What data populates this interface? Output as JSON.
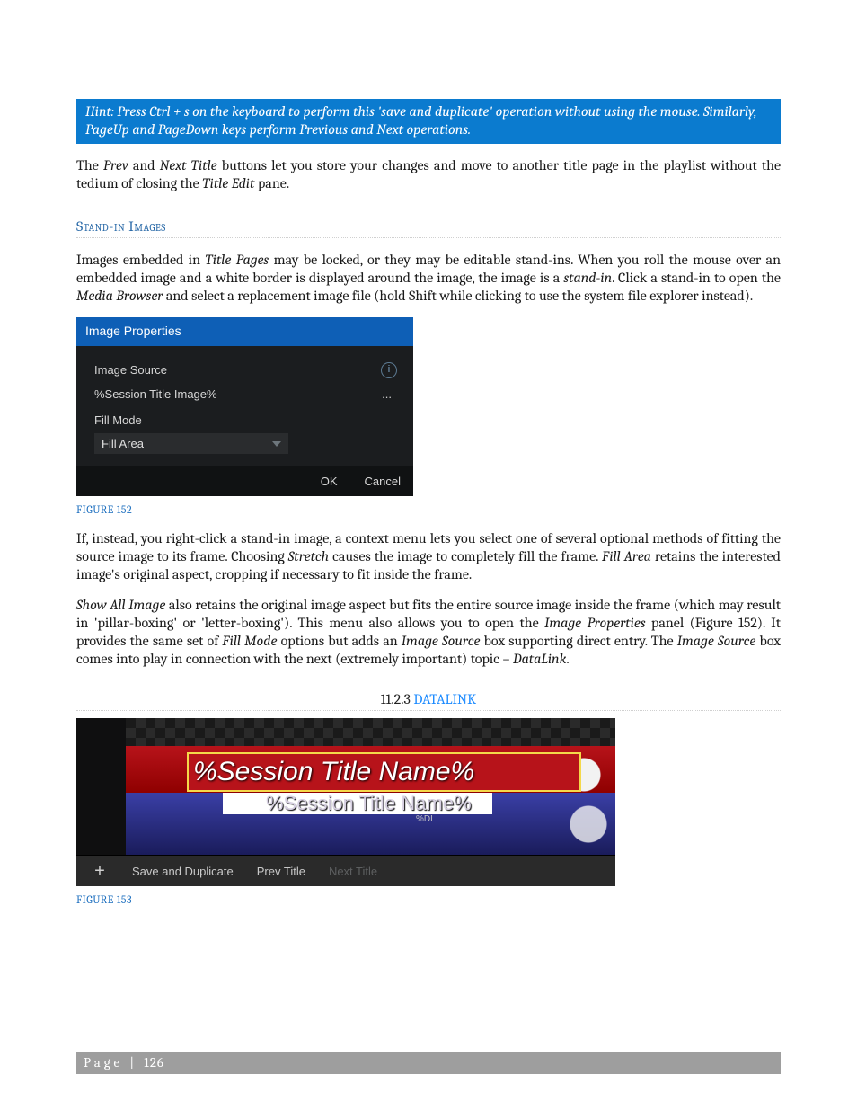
{
  "hint": "Hint: Press Ctrl + s on the keyboard to perform this 'save and duplicate' operation without using the mouse. Similarly, PageUp and PageDown keys perform Previous and Next operations.",
  "para1_a": "The ",
  "para1_prev": "Prev",
  "para1_b": " and ",
  "para1_next": "Next Title",
  "para1_c": " buttons let you store your changes and move to another title page in the playlist without the tedium of closing the ",
  "para1_te": "Title Edit",
  "para1_d": " pane.",
  "section_standin": "Stand-in Images",
  "para2_a": "Images embedded in ",
  "para2_tp": "Title Pages",
  "para2_b": " may be locked, or they may be editable stand-ins.  When you roll the mouse over an embedded image and a white border is displayed around the image, the image is a ",
  "para2_si": "stand-in",
  "para2_c": ".  Click a stand-in to open the ",
  "para2_mb": "Media Browser",
  "para2_d": " and select a replacement image file (hold Shift while clicking to use the system file explorer instead).",
  "dialog": {
    "title": "Image Properties",
    "image_source_label": "Image Source",
    "image_source_value": "%Session Title Image%",
    "browse": "...",
    "fill_mode_label": "Fill Mode",
    "fill_mode_value": "Fill Area",
    "ok": "OK",
    "cancel": "Cancel"
  },
  "caption152": "Figure 152",
  "para3_a": "If, instead, you right-click a stand-in image, a context menu lets you select one of several optional methods of fitting the source image to its frame.  Choosing ",
  "para3_str": "Stretch",
  "para3_b": " causes the image to completely fill the frame.  ",
  "para3_fa": "Fill Area",
  "para3_c": " retains the interested image's original aspect, cropping if necessary to fit inside the frame.",
  "para4_a": "Show All Image",
  "para4_b": " also retains the original image aspect but fits the entire source image inside the frame (which may result in 'pillar-boxing' or 'letter-boxing'). This menu also allows you to open the ",
  "para4_ip": "Image Properties",
  "para4_c": " panel (Figure 152).  It provides the same set of ",
  "para4_fm": "Fill Mode",
  "para4_d": " options but adds an ",
  "para4_is": "Image Source",
  "para4_e": " box supporting direct entry.  The ",
  "para4_is2": "Image Source",
  "para4_f": " box comes into play in connection with the next (extremely important) topic – ",
  "para4_dl": "DataLink",
  "para4_g": ".",
  "datalink": {
    "num": "11.2.3 ",
    "label": "DATALINK"
  },
  "fig153": {
    "line1": "%Session Title Name%",
    "line2": "%Session Title Name%",
    "dl": "%DL",
    "save_dup": "Save and Duplicate",
    "prev": "Prev Title",
    "next": "Next Title"
  },
  "caption153": "Figure 153",
  "footer": {
    "label": "Page | ",
    "num": "126"
  }
}
